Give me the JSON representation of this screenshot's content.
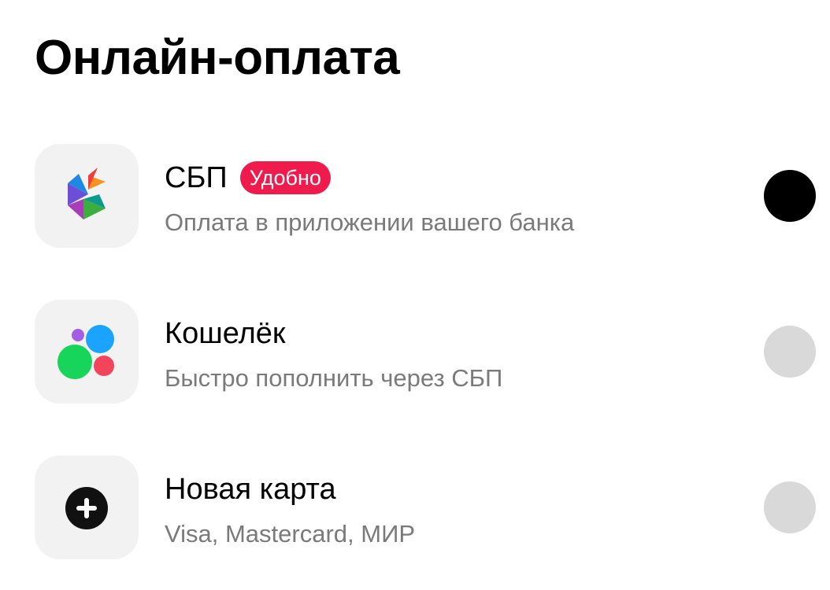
{
  "page": {
    "title": "Онлайн-оплата"
  },
  "options": [
    {
      "icon": "sbp-logo-icon",
      "title": "СБП",
      "badge": "Удобно",
      "subtitle": "Оплата в приложении вашего банка",
      "selected": true
    },
    {
      "icon": "wallet-dots-icon",
      "title": "Кошелёк",
      "subtitle": "Быстро пополнить через СБП",
      "selected": false
    },
    {
      "icon": "plus-circle-icon",
      "title": "Новая карта",
      "subtitle": "Visa, Mastercard, МИР",
      "selected": false
    }
  ],
  "colors": {
    "badge_background": "#ef1b4c",
    "radio_selected": "#000000",
    "radio_unselected": "#d9d9d9",
    "tile_background": "#f2f2f2",
    "subtitle_text": "#7a7a7a"
  }
}
